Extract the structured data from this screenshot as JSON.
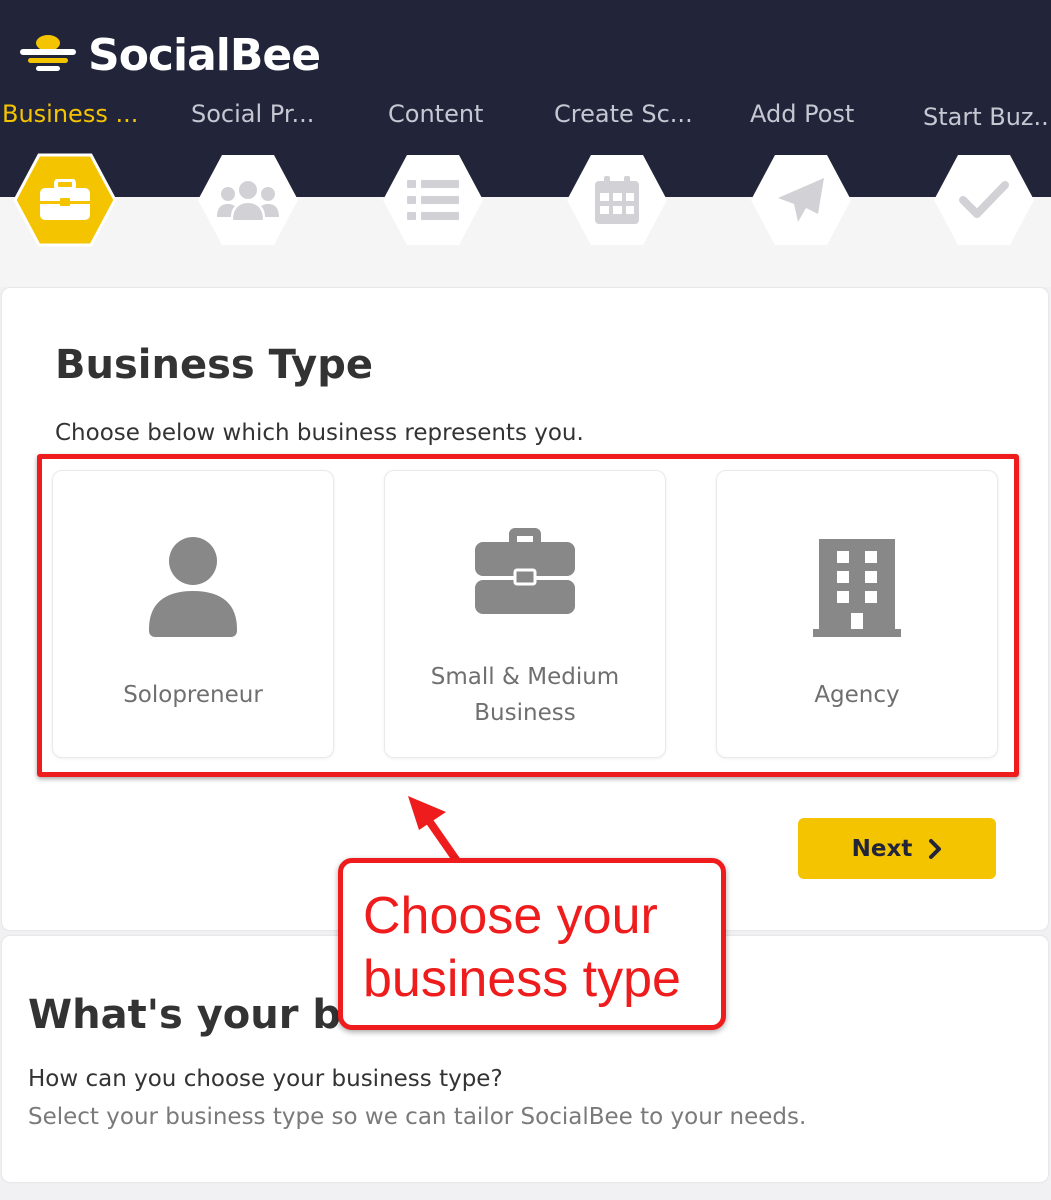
{
  "app": {
    "name": "SocialBee"
  },
  "steps": [
    {
      "label": "Business ...",
      "icon": "briefcase-icon",
      "active": true
    },
    {
      "label": "Social Pr...",
      "icon": "users-icon",
      "active": false
    },
    {
      "label": "Content",
      "icon": "list-icon",
      "active": false
    },
    {
      "label": "Create Sc...",
      "icon": "calendar-icon",
      "active": false
    },
    {
      "label": "Add Post",
      "icon": "paper-plane-icon",
      "active": false
    },
    {
      "label": "Start Buz...",
      "icon": "checkmark-icon",
      "active": false
    }
  ],
  "business_type": {
    "title": "Business Type",
    "subtitle": "Choose below which business represents you.",
    "options": [
      {
        "line1": "Solopreneur",
        "line2": "",
        "icon": "person-icon"
      },
      {
        "line1": "Small & Medium",
        "line2": "Business",
        "icon": "briefcase-icon"
      },
      {
        "line1": "Agency",
        "line2": "",
        "icon": "building-icon"
      }
    ],
    "next_label": "Next"
  },
  "annotation": {
    "line1": "Choose your",
    "line2": "business type"
  },
  "info_card": {
    "title": "What's your business",
    "question": "How can you choose your business type?",
    "description": "Select your business type so we can tailor SocialBee to your needs."
  },
  "colors": {
    "header_bg": "#22253a",
    "accent": "#f5c400",
    "annotation_red": "#ee1c1c"
  }
}
